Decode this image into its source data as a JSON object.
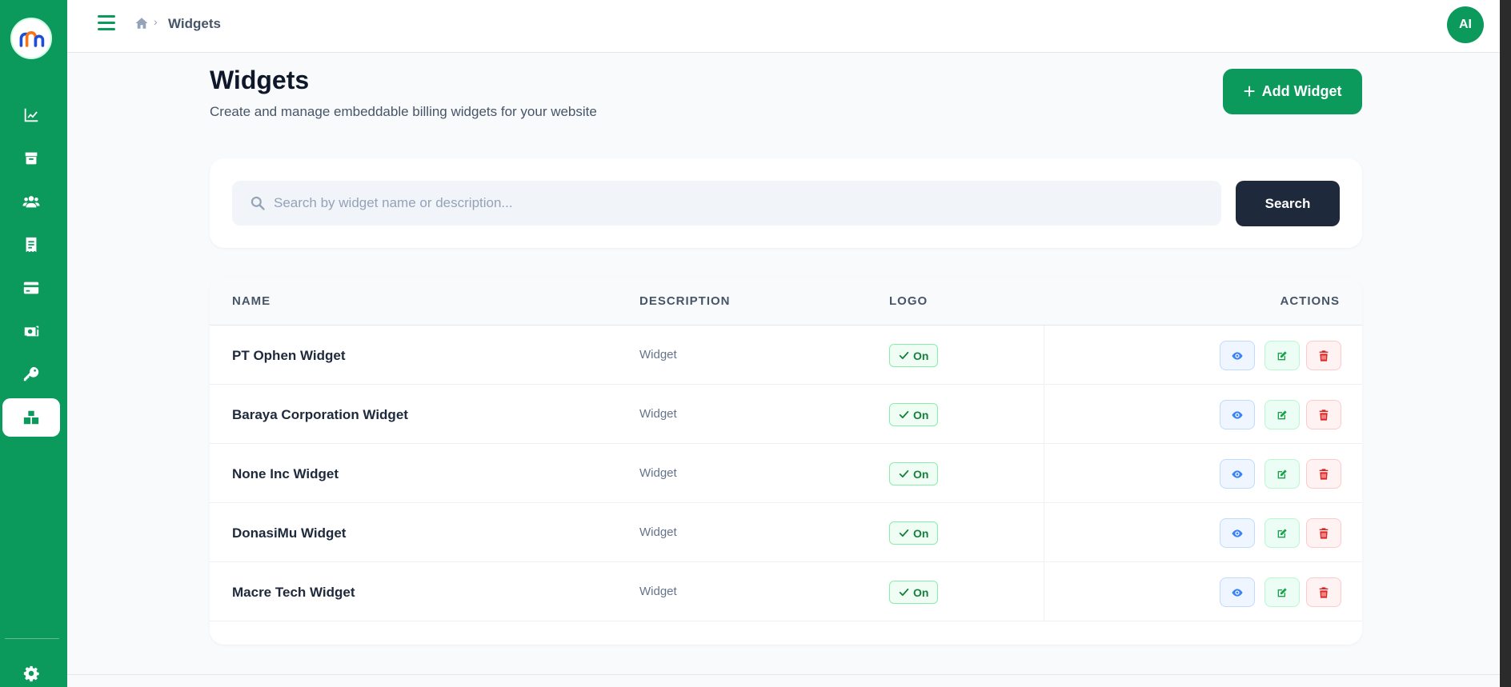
{
  "topbar": {
    "breadcrumb_label": "Widgets",
    "avatar_initials": "AI"
  },
  "sidebar": {
    "items": [
      {
        "name": "analytics",
        "icon": "chart-line-icon"
      },
      {
        "name": "products",
        "icon": "box-icon"
      },
      {
        "name": "customers",
        "icon": "users-icon"
      },
      {
        "name": "invoices",
        "icon": "receipt-icon"
      },
      {
        "name": "payments",
        "icon": "credit-card-icon"
      },
      {
        "name": "transactions",
        "icon": "money-transfer-icon"
      },
      {
        "name": "api-keys",
        "icon": "key-icon"
      },
      {
        "name": "widgets",
        "icon": "cubes-icon",
        "active": true
      }
    ],
    "footer_icon": "gear-icon"
  },
  "header": {
    "title": "Widgets",
    "subtitle": "Create and manage embeddable billing widgets for your website",
    "add_button": "Add Widget"
  },
  "search": {
    "placeholder": "Search by widget name or description...",
    "button": "Search"
  },
  "table": {
    "columns": [
      "NAME",
      "DESCRIPTION",
      "LOGO",
      "ACTIONS"
    ],
    "rows": [
      {
        "name": "PT Ophen Widget",
        "description": "Widget",
        "logo": "On"
      },
      {
        "name": "Baraya Corporation Widget",
        "description": "Widget",
        "logo": "On"
      },
      {
        "name": "None Inc Widget",
        "description": "Widget",
        "logo": "On"
      },
      {
        "name": "DonasiMu Widget",
        "description": "Widget",
        "logo": "On"
      },
      {
        "name": "Macre Tech Widget",
        "description": "Widget",
        "logo": "On"
      }
    ]
  },
  "colors": {
    "brand_green": "#0c9a5c",
    "dark_button": "#1e293b",
    "view_blue": "#3b82f6",
    "edit_green": "#16a34a",
    "delete_red": "#dc2626"
  }
}
